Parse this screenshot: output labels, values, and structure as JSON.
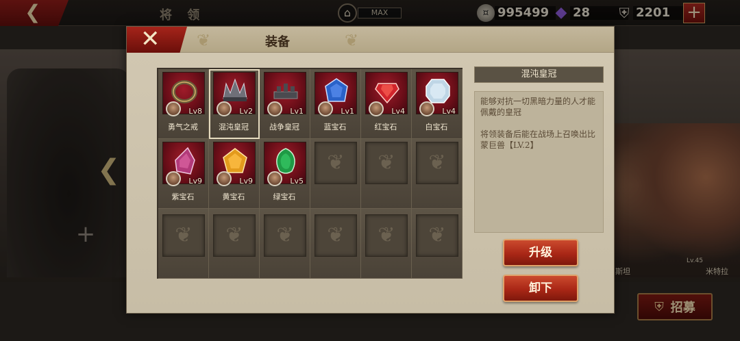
{
  "topbar": {
    "title": "将 领",
    "level_badge": "MAX",
    "resources": [
      {
        "icon": "silver-coin-icon",
        "value": "995499"
      },
      {
        "icon": "purple-gem-icon",
        "value": "28"
      },
      {
        "icon": "helmet-icon",
        "value": "2201"
      }
    ],
    "add_label": "+"
  },
  "background": {
    "hero_captions": [
      "斯坦",
      "米特拉"
    ],
    "hero_levels": [
      "Lv.45"
    ],
    "recruit_label": "招募"
  },
  "modal": {
    "title": "装备",
    "items": [
      {
        "name": "勇气之戒",
        "level": "Lv8",
        "icon": "ring-icon",
        "color": "#6b5a3a"
      },
      {
        "name": "混沌皇冠",
        "level": "Lv2",
        "icon": "spiked-crown-icon",
        "color": "#6f6f78",
        "selected": true
      },
      {
        "name": "战争皇冠",
        "level": "Lv1",
        "icon": "dark-crown-icon",
        "color": "#4a4a4f"
      },
      {
        "name": "蓝宝石",
        "level": "Lv1",
        "icon": "sapphire-icon",
        "color": "#2a62c8"
      },
      {
        "name": "红宝石",
        "level": "Lv4",
        "icon": "ruby-icon",
        "color": "#d2252c"
      },
      {
        "name": "白宝石",
        "level": "Lv4",
        "icon": "diamond-icon",
        "color": "#bfd6e6"
      },
      {
        "name": "紫宝石",
        "level": "Lv9",
        "icon": "amethyst-icon",
        "color": "#b23a7a"
      },
      {
        "name": "黄宝石",
        "level": "Lv9",
        "icon": "topaz-icon",
        "color": "#e39a1c"
      },
      {
        "name": "绿宝石",
        "level": "Lv5",
        "icon": "emerald-icon",
        "color": "#1f9a45"
      }
    ],
    "empty_slot_count": 9,
    "detail": {
      "name": "混沌皇冠",
      "description": "能够对抗一切黑暗力量的人才能佩戴的皇冠",
      "effect": "将领装备后能在战场上召唤出比蒙巨兽【LV.2】"
    },
    "buttons": {
      "upgrade": "升级",
      "unequip": "卸下"
    }
  }
}
